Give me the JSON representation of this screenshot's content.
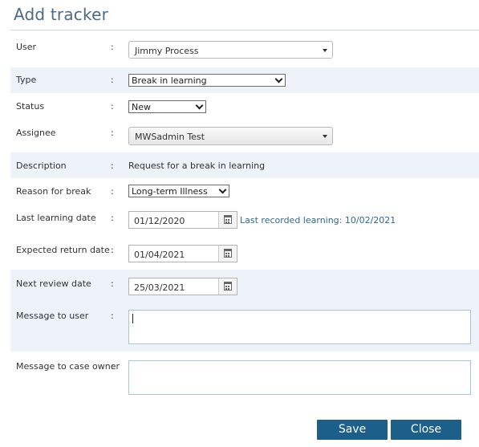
{
  "title": "Add tracker",
  "fields": {
    "user": {
      "label": "User",
      "colon": ":",
      "value": "Jimmy Process"
    },
    "type": {
      "label": "Type",
      "colon": ":",
      "value": "Break in learning"
    },
    "status": {
      "label": "Status",
      "colon": ":",
      "value": "New"
    },
    "assignee": {
      "label": "Assignee",
      "colon": ":",
      "value": "MWSadmin Test"
    },
    "description": {
      "label": "Description",
      "colon": ":",
      "value": "Request for a break in learning"
    },
    "reason": {
      "label": "Reason for break",
      "colon": ":",
      "value": "Long-term Illness"
    },
    "last_learning": {
      "label": "Last learning date",
      "colon": ":",
      "value": "01/12/2020",
      "hint": "Last recorded learning: 10/02/2021"
    },
    "expected_return": {
      "label": "Expected return date",
      "colon": ":",
      "value": "01/04/2021"
    },
    "next_review": {
      "label": "Next review date",
      "colon": ":",
      "value": "25/03/2021"
    },
    "message_user": {
      "label": "Message to user",
      "colon": ":",
      "value": ""
    },
    "message_owner": {
      "label": "Message to case owner",
      "colon": ":",
      "value": ""
    }
  },
  "buttons": {
    "save": "Save",
    "close": "Close"
  },
  "colors": {
    "primary": "#1c5f8a",
    "alt_row": "#edf3f9",
    "title": "#4d6a80",
    "link": "#2f6b8f"
  }
}
